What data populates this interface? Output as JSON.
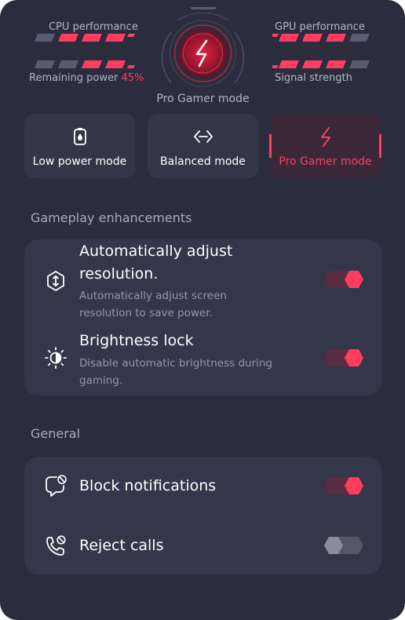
{
  "top_stats": {
    "cpu_label": "CPU performance",
    "gpu_label": "GPU performance",
    "remaining_power_label": "Remaining power",
    "remaining_power_value": "45%",
    "signal_label": "Signal strength",
    "cpu_level": 0.75,
    "gpu_level": 0.75,
    "remaining_power_level": 0.5,
    "signal_level": 0.75
  },
  "current_mode_label": "Pro Gamer mode",
  "modes": [
    {
      "label": "Low power mode",
      "icon": "battery-icon",
      "active": false
    },
    {
      "label": "Balanced mode",
      "icon": "balance-arrows-icon",
      "active": false
    },
    {
      "label": "Pro Gamer mode",
      "icon": "lightning-icon",
      "active": true
    }
  ],
  "gameplay": {
    "title": "Gameplay enhancements",
    "items": [
      {
        "title": "Automatically adjust resolution.",
        "desc": "Automatically adjust screen resolution to save power.",
        "icon": "resolution-icon",
        "enabled": true
      },
      {
        "title": "Brightness lock",
        "desc": "Disable automatic brightness during gaming.",
        "icon": "brightness-icon",
        "enabled": true
      }
    ]
  },
  "general": {
    "title": "General",
    "items": [
      {
        "title": "Block notifications",
        "icon": "block-notifications-icon",
        "enabled": true
      },
      {
        "title": "Reject calls",
        "icon": "reject-calls-icon",
        "enabled": false
      }
    ]
  },
  "colors": {
    "panel_bg": "#2b2d3f",
    "card_bg": "#34364a",
    "accent": "#ff3d5e",
    "text": "#ffffff",
    "muted_text": "#9698a8"
  }
}
